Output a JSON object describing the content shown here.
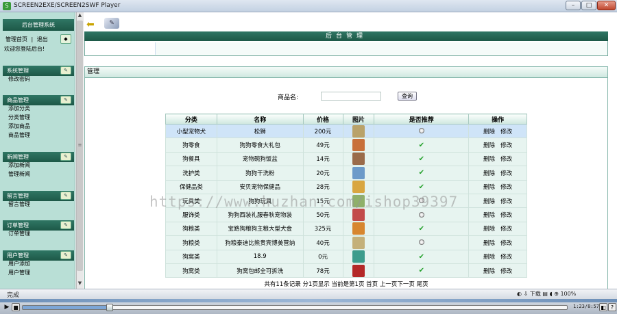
{
  "window": {
    "title": "SCREEN2EXE/SCREEN2SWF Player",
    "min": "–",
    "max": "□",
    "close": "✕"
  },
  "sidebar": {
    "title": "后台管理系统",
    "nav_home": "管理首页",
    "nav_sep": "|",
    "nav_logout": "退出",
    "welcome": "欢迎您登陆后台!",
    "groups": [
      {
        "header": "系统管理",
        "items": [
          "修改密码"
        ]
      },
      {
        "header": "商品管理",
        "items": [
          "添加分类",
          "分类管理",
          "添加商品",
          "商品管理"
        ]
      },
      {
        "header": "新闻管理",
        "items": [
          "添加新闻",
          "管理新闻"
        ]
      },
      {
        "header": "留言管理",
        "items": [
          "留言管理"
        ]
      },
      {
        "header": "订单管理",
        "items": [
          "订单管理"
        ]
      },
      {
        "header": "用户管理",
        "items": [
          "用户添加",
          "用户管理"
        ]
      }
    ]
  },
  "scroll": {
    "up": "▲",
    "down": "▼",
    "grip": "≡"
  },
  "main": {
    "header_title": "后台管理",
    "section_title": "管理",
    "search": {
      "label": "商品名:",
      "value": "",
      "button": "查询"
    }
  },
  "table": {
    "headers": [
      "分类",
      "名称",
      "价格",
      "图片",
      "是否推荐",
      "操作"
    ],
    "ops": [
      "删除",
      "修改"
    ],
    "rows": [
      {
        "category": "小型宠物犬",
        "name": "松狮",
        "price": "200元",
        "img_color": "#b9a26a",
        "recommended": false
      },
      {
        "category": "狗零食",
        "name": "狗狗零食大礼包",
        "price": "49元",
        "img_color": "#c8703a",
        "recommended": true
      },
      {
        "category": "狗餐具",
        "name": "宠物碗狗饭盆",
        "price": "14元",
        "img_color": "#9a6b4a",
        "recommended": true
      },
      {
        "category": "洗护类",
        "name": "狗狗干洗粉",
        "price": "20元",
        "img_color": "#6c9ac9",
        "recommended": true
      },
      {
        "category": "保健品类",
        "name": "安贝宠物保健品",
        "price": "28元",
        "img_color": "#d9a640",
        "recommended": true
      },
      {
        "category": "玩具类",
        "name": "狗狗玩具",
        "price": "15元",
        "img_color": "#8fb06a",
        "recommended": false
      },
      {
        "category": "服饰类",
        "name": "狗狗西装礼服春秋宠物装",
        "price": "50元",
        "img_color": "#c24a4a",
        "recommended": false
      },
      {
        "category": "狗粮类",
        "name": "宝路狗粮狗主粮大型犬金",
        "price": "325元",
        "img_color": "#d7862f",
        "recommended": true
      },
      {
        "category": "狗粮类",
        "name": "狗粮泰迪比熊贵宾博美营纳",
        "price": "40元",
        "img_color": "#c4b07a",
        "recommended": false
      },
      {
        "category": "狗窝类",
        "name": "18.9",
        "price": "0元",
        "img_color": "#3d9c8c",
        "recommended": true
      },
      {
        "category": "狗窝类",
        "name": "狗窝包邮全可拆洗",
        "price": "78元",
        "img_color": "#b42828",
        "recommended": true
      }
    ],
    "footer": "共有11条记录  分1页显示  当前是第1页  首页  上一页下一页  尾页"
  },
  "watermark": "https://www.huzhan.com/ishop39397",
  "statusbar": {
    "text": "完成",
    "download": "下载",
    "zoom": "100%"
  },
  "player": {
    "play": "▶",
    "stop": "■",
    "timecode": "1:23/8:57",
    "progress": 0.16,
    "snap": "◧",
    "info": "?"
  }
}
